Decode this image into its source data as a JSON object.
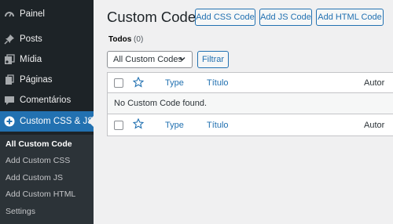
{
  "sidebar": {
    "items": [
      {
        "label": "Painel",
        "icon": "dashboard-icon"
      },
      {
        "label": "Posts",
        "icon": "pin-icon"
      },
      {
        "label": "Mídia",
        "icon": "media-icon"
      },
      {
        "label": "Páginas",
        "icon": "pages-icon"
      },
      {
        "label": "Comentários",
        "icon": "comments-icon"
      },
      {
        "label": "Custom CSS & JS",
        "icon": "plus-circle-icon"
      }
    ],
    "submenu": [
      "All Custom Code",
      "Add Custom CSS",
      "Add Custom JS",
      "Add Custom HTML",
      "Settings"
    ]
  },
  "header": {
    "title": "Custom Code",
    "buttons": [
      "Add CSS Code",
      "Add JS Code",
      "Add HTML Code"
    ]
  },
  "views": {
    "label": "Todos",
    "count": "(0)"
  },
  "filter": {
    "selected": "All Custom Codes",
    "button": "Filtrar"
  },
  "table": {
    "columns": {
      "type": "Type",
      "title": "Título",
      "author": "Autor"
    },
    "empty_message": "No Custom Code found."
  },
  "colors": {
    "accent": "#2271b1",
    "sidebar": "#1d2327",
    "submenu": "#2c3338"
  }
}
